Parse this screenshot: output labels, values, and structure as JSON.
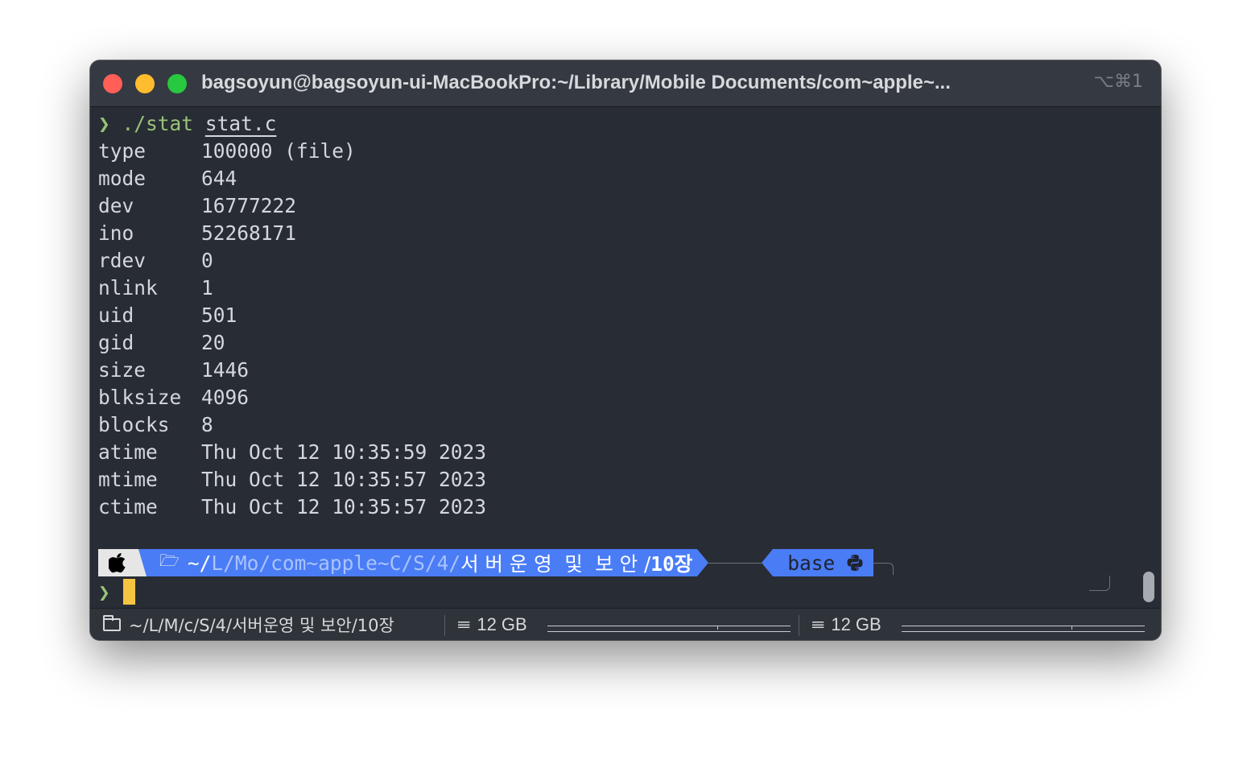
{
  "window": {
    "title": "bagsoyun@bagsoyun-ui-MacBookPro:~/Library/Mobile Documents/com~apple~...",
    "shortcut": "⌥⌘1"
  },
  "terminal": {
    "prompt_symbol": "❯",
    "command": "./stat",
    "argument": "stat.c",
    "rows": [
      {
        "key": "type",
        "value": "100000 (file)"
      },
      {
        "key": "mode",
        "value": "644"
      },
      {
        "key": "dev",
        "value": "16777222"
      },
      {
        "key": "ino",
        "value": "52268171"
      },
      {
        "key": "rdev",
        "value": "0"
      },
      {
        "key": "nlink",
        "value": "1"
      },
      {
        "key": "uid",
        "value": "501"
      },
      {
        "key": "gid",
        "value": "20"
      },
      {
        "key": "size",
        "value": "1446"
      },
      {
        "key": "blksize",
        "value": "4096"
      },
      {
        "key": "blocks",
        "value": "8"
      },
      {
        "key": "atime",
        "value": "Thu Oct 12 10:35:59 2023"
      },
      {
        "key": "mtime",
        "value": "Thu Oct 12 10:35:57 2023"
      },
      {
        "key": "ctime",
        "value": "Thu Oct 12 10:35:57 2023"
      }
    ]
  },
  "powerline": {
    "folder_glyph": "🗁",
    "path_prefix": "~/",
    "path_segments": "L/Mo/com~apple~C/S/4/",
    "path_korean": "서 버 운 영  및  보 안 /",
    "path_current": "10장",
    "env_name": "base",
    "env_icon": "python-icon"
  },
  "cursor_prompt": "❯",
  "statusbar": {
    "path": "~/L/M/c/S/4/서버운영 및 보안/10장",
    "disk1_glyph": "𝍢",
    "disk1_label": "12 GB",
    "disk2_glyph": "𝍢",
    "disk2_label": "12 GB",
    "disk_usage_fraction": 0.7
  },
  "colors": {
    "accent_blue": "#4a7cf5",
    "prompt_green": "#98c379",
    "cursor_yellow": "#f5c542"
  }
}
